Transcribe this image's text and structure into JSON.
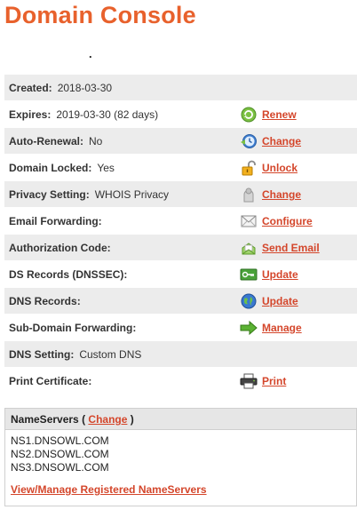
{
  "header": {
    "title": "Domain Console",
    "subtitle": "."
  },
  "rows": [
    {
      "label": "Created:",
      "value": "2018-03-30"
    },
    {
      "label": "Expires:",
      "value": "2019-03-30 (82 days)",
      "action": "Renew",
      "icon": "renew-icon"
    },
    {
      "label": "Auto-Renewal:",
      "value": "No",
      "action": "Change",
      "icon": "clock-icon"
    },
    {
      "label": "Domain Locked:",
      "value": "Yes",
      "action": "Unlock",
      "icon": "padlock-icon"
    },
    {
      "label": "Privacy Setting:",
      "value": "WHOIS Privacy",
      "action": "Change",
      "icon": "privacy-icon"
    },
    {
      "label": "Email Forwarding:",
      "value": "",
      "action": "Configure",
      "icon": "envelope-icon"
    },
    {
      "label": "Authorization Code:",
      "value": "",
      "action": "Send Email",
      "icon": "mail-send-icon"
    },
    {
      "label": "DS Records (DNSSEC):",
      "value": "",
      "action": "Update",
      "icon": "key-icon"
    },
    {
      "label": "DNS Records:",
      "value": "",
      "action": "Update",
      "icon": "globe-icon"
    },
    {
      "label": "Sub-Domain Forwarding:",
      "value": "",
      "action": "Manage",
      "icon": "arrow-right-icon"
    },
    {
      "label": "DNS Setting:",
      "value": "Custom DNS"
    },
    {
      "label": "Print Certificate:",
      "value": "",
      "action": "Print",
      "icon": "printer-icon"
    }
  ],
  "nameservers": {
    "heading": "NameServers",
    "open_paren": " ( ",
    "change_label": "Change",
    "close_paren": " )",
    "servers": [
      "NS1.DNSOWL.COM",
      "NS2.DNSOWL.COM",
      "NS3.DNSOWL.COM"
    ],
    "manage_link": "View/Manage Registered NameServers"
  },
  "colors": {
    "accent": "#e8612c",
    "link": "#d4462b",
    "row_alt": "#ececec"
  }
}
